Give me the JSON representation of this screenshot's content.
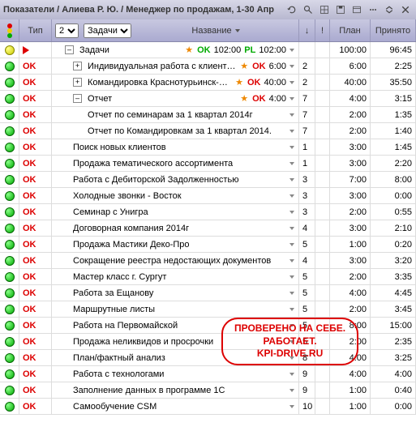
{
  "titlebar": {
    "title": "Показатели / Алиева Р. Ю. / Менеджер по продажам, 1-30 Апр"
  },
  "header": {
    "tip": "Тип",
    "level_val": "2",
    "category_val": "Задачи",
    "name": "Название",
    "plan": "План",
    "accepted": "Принято",
    "excl": "!"
  },
  "stamp": {
    "l1": "ПРОВЕРЕНО НА СЕБЕ.",
    "l2": "РАБОТАЕТ.",
    "l3": "KPI-DRIVE.RU"
  },
  "rows": [
    {
      "light": "yellow",
      "tip": "arrow",
      "name": "Задачи",
      "pm": "-",
      "indent": 1,
      "star": true,
      "okg": "OK",
      "val1": "102:00",
      "pl": "PL",
      "val2": "102:00",
      "flag": "",
      "plan": "100:00",
      "accepted": "96:45"
    },
    {
      "light": "green",
      "tip": "OK",
      "name": "Индивидуальная работа с клиентами",
      "pm": "+",
      "indent": 2,
      "star": true,
      "okr": "OK",
      "rval": "6:00",
      "flag": "2",
      "plan": "6:00",
      "accepted": "2:25"
    },
    {
      "light": "green",
      "tip": "OK",
      "name": "Командировка Краснотурьинск-Серов",
      "pm": "+",
      "indent": 2,
      "star": true,
      "okr": "OK",
      "rval": "40:00",
      "flag": "2",
      "plan": "40:00",
      "accepted": "35:50"
    },
    {
      "light": "green",
      "tip": "OK",
      "name": "Отчет",
      "pm": "-",
      "indent": 2,
      "star": true,
      "okr": "OK",
      "rval": "4:00",
      "flag": "7",
      "plan": "4:00",
      "accepted": "3:15"
    },
    {
      "light": "green",
      "tip": "OK",
      "name": "Отчет по семинарам за 1 квартал 2014г",
      "indent": 3,
      "flag": "7",
      "plan": "2:00",
      "accepted": "1:35"
    },
    {
      "light": "green",
      "tip": "OK",
      "name": "Отчет по Командировкам за 1 квартал 2014.",
      "indent": 3,
      "flag": "7",
      "plan": "2:00",
      "accepted": "1:40"
    },
    {
      "light": "green",
      "tip": "OK",
      "name": "Поиск новых клиентов",
      "indent": 2,
      "flag": "1",
      "plan": "3:00",
      "accepted": "1:45"
    },
    {
      "light": "green",
      "tip": "OK",
      "name": "Продажа тематического ассортимента",
      "indent": 2,
      "flag": "1",
      "plan": "3:00",
      "accepted": "2:20"
    },
    {
      "light": "green",
      "tip": "OK",
      "name": "Работа с Дебиторской Задолженностью",
      "indent": 2,
      "flag": "3",
      "plan": "7:00",
      "accepted": "8:00"
    },
    {
      "light": "green",
      "tip": "OK",
      "name": "Холодные звонки - Восток",
      "indent": 2,
      "flag": "3",
      "plan": "3:00",
      "accepted": "0:00"
    },
    {
      "light": "green",
      "tip": "OK",
      "name": "Семинар с Унигра",
      "indent": 2,
      "flag": "3",
      "plan": "2:00",
      "accepted": "0:55"
    },
    {
      "light": "green",
      "tip": "OK",
      "name": "Договорная компания 2014г",
      "indent": 2,
      "flag": "4",
      "plan": "3:00",
      "accepted": "2:10"
    },
    {
      "light": "green",
      "tip": "OK",
      "name": "Продажа Мастики Деко-Про",
      "indent": 2,
      "flag": "5",
      "plan": "1:00",
      "accepted": "0:20"
    },
    {
      "light": "green",
      "tip": "OK",
      "name": "Сокращение реестра недостающих документов",
      "indent": 2,
      "flag": "4",
      "plan": "3:00",
      "accepted": "3:20"
    },
    {
      "light": "green",
      "tip": "OK",
      "name": "Мастер класс г. Сургут",
      "indent": 2,
      "flag": "5",
      "plan": "2:00",
      "accepted": "3:35"
    },
    {
      "light": "green",
      "tip": "OK",
      "name": "Работа за Ещанову",
      "indent": 2,
      "flag": "5",
      "plan": "4:00",
      "accepted": "4:45"
    },
    {
      "light": "green",
      "tip": "OK",
      "name": "Маршрутные листы",
      "indent": 2,
      "flag": "5",
      "plan": "2:00",
      "accepted": "3:45"
    },
    {
      "light": "green",
      "tip": "OK",
      "name": "Работа на Первомайской",
      "indent": 2,
      "flag": "5",
      "plan": "8:00",
      "accepted": "15:00"
    },
    {
      "light": "green",
      "tip": "OK",
      "name": "Продажа неликвидов и просрочки",
      "indent": 2,
      "flag": "5",
      "plan": "2:00",
      "accepted": "2:35"
    },
    {
      "light": "green",
      "tip": "OK",
      "name": "План/фактный анализ",
      "indent": 2,
      "flag": "8",
      "plan": "4:00",
      "accepted": "3:25"
    },
    {
      "light": "green",
      "tip": "OK",
      "name": "Работа с технологами",
      "indent": 2,
      "flag": "9",
      "plan": "4:00",
      "accepted": "4:00"
    },
    {
      "light": "green",
      "tip": "OK",
      "name": "Заполнение данных в программе 1С",
      "indent": 2,
      "flag": "9",
      "plan": "1:00",
      "accepted": "0:40"
    },
    {
      "light": "green",
      "tip": "OK",
      "name": "Самообучение CSM",
      "indent": 2,
      "flag": "10",
      "plan": "1:00",
      "accepted": "0:00"
    }
  ]
}
